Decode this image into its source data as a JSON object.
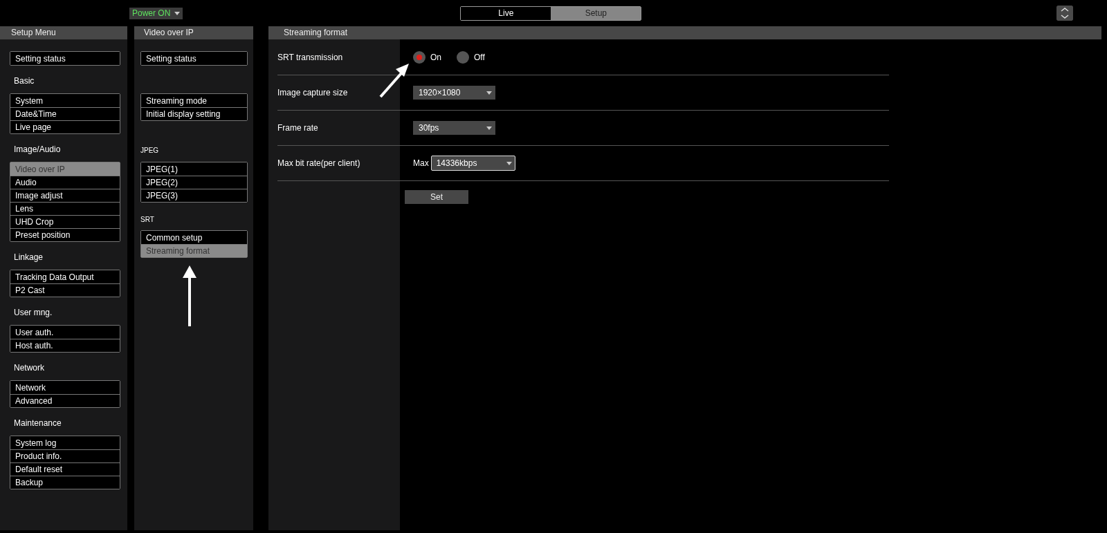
{
  "top_bar": {
    "power": {
      "label": "Power ON"
    },
    "tabs": [
      {
        "label": "Live",
        "selected": false
      },
      {
        "label": "Setup",
        "selected": true
      }
    ]
  },
  "setup_menu": {
    "title": "Setup Menu",
    "groups": [
      {
        "items": [
          {
            "label": "Setting status",
            "selected": false
          }
        ]
      },
      {
        "heading": "Basic",
        "items": [
          {
            "label": "System",
            "selected": false
          },
          {
            "label": "Date&Time",
            "selected": false
          },
          {
            "label": "Live page",
            "selected": false
          }
        ]
      },
      {
        "heading": "Image/Audio",
        "items": [
          {
            "label": "Video over IP",
            "selected": true
          },
          {
            "label": "Audio",
            "selected": false
          },
          {
            "label": "Image adjust",
            "selected": false
          },
          {
            "label": "Lens",
            "selected": false
          },
          {
            "label": "UHD Crop",
            "selected": false
          },
          {
            "label": "Preset position",
            "selected": false
          }
        ]
      },
      {
        "heading": "Linkage",
        "items": [
          {
            "label": "Tracking Data Output",
            "selected": false
          },
          {
            "label": "P2 Cast",
            "selected": false
          }
        ]
      },
      {
        "heading": "User mng.",
        "items": [
          {
            "label": "User auth.",
            "selected": false
          },
          {
            "label": "Host auth.",
            "selected": false
          }
        ]
      },
      {
        "heading": "Network",
        "items": [
          {
            "label": "Network",
            "selected": false
          },
          {
            "label": "Advanced",
            "selected": false
          }
        ]
      },
      {
        "heading": "Maintenance",
        "items": [
          {
            "label": "System log",
            "selected": false
          },
          {
            "label": "Product info.",
            "selected": false
          },
          {
            "label": "Default reset",
            "selected": false
          },
          {
            "label": "Backup",
            "selected": false
          }
        ]
      }
    ]
  },
  "sub_menu": {
    "title": "Video over IP",
    "groups": [
      {
        "items": [
          {
            "label": "Setting status",
            "selected": false
          }
        ]
      },
      {
        "items": [
          {
            "label": "Streaming mode",
            "selected": false
          },
          {
            "label": "Initial display setting",
            "selected": false
          }
        ]
      },
      {
        "heading": "JPEG",
        "items": [
          {
            "label": "JPEG(1)",
            "selected": false
          },
          {
            "label": "JPEG(2)",
            "selected": false
          },
          {
            "label": "JPEG(3)",
            "selected": false
          }
        ]
      },
      {
        "heading": "SRT",
        "items": [
          {
            "label": "Common setup",
            "selected": false
          },
          {
            "label": "Streaming format",
            "selected": true
          }
        ]
      }
    ]
  },
  "settings": {
    "title": "Streaming format",
    "rows": [
      {
        "kind": "radio",
        "label": "SRT transmission",
        "options": [
          {
            "label": "On",
            "selected": true
          },
          {
            "label": "Off",
            "selected": false
          }
        ]
      },
      {
        "kind": "select",
        "label": "Image capture size",
        "value": "1920×1080"
      },
      {
        "kind": "select",
        "label": "Frame rate",
        "value": "30fps"
      },
      {
        "kind": "select",
        "label": "Max bit rate(per client)",
        "prefix": "Max",
        "value": "14336kbps",
        "focused": true
      }
    ],
    "set_button": "Set"
  }
}
